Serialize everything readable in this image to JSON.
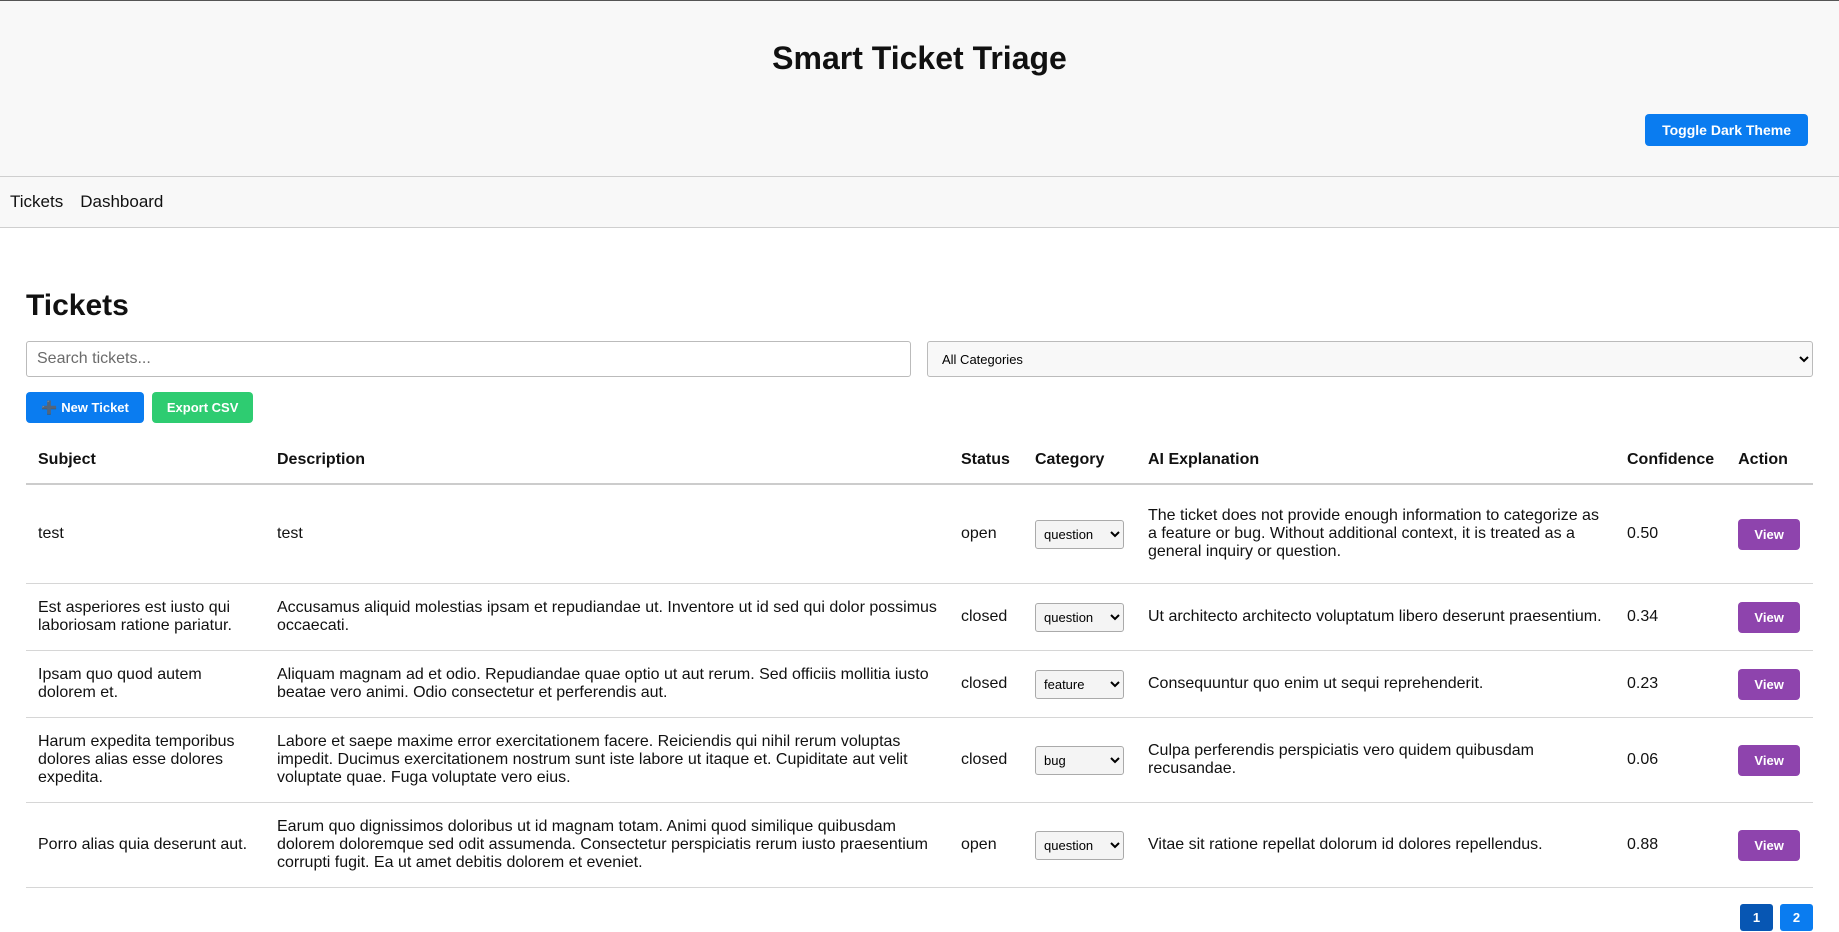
{
  "header": {
    "title": "Smart Ticket Triage",
    "theme_button": "Toggle Dark Theme"
  },
  "nav": {
    "items": [
      "Tickets",
      "Dashboard"
    ]
  },
  "page": {
    "title": "Tickets"
  },
  "filters": {
    "search_placeholder": "Search tickets...",
    "category_selected": "All Categories"
  },
  "actions": {
    "new_ticket": "New Ticket",
    "new_ticket_icon": "plus-icon",
    "export_csv": "Export CSV"
  },
  "colors": {
    "primary": "#0a7cf0",
    "success": "#2ecc71",
    "view": "#8e44ad",
    "active_page": "#0756b3"
  },
  "table": {
    "headers": [
      "Subject",
      "Description",
      "Status",
      "Category",
      "AI Explanation",
      "Confidence",
      "Action"
    ],
    "rows": [
      {
        "subject": "test",
        "description": "test",
        "status": "open",
        "category": "question",
        "ai_explanation": "The ticket does not provide enough information to categorize as a feature or bug. Without additional context, it is treated as a general inquiry or question.",
        "confidence": "0.50",
        "action": "View"
      },
      {
        "subject": "Est asperiores est iusto qui laboriosam ratione pariatur.",
        "description": "Accusamus aliquid molestias ipsam et repudiandae ut. Inventore ut id sed qui dolor possimus occaecati.",
        "status": "closed",
        "category": "question",
        "ai_explanation": "Ut architecto architecto voluptatum libero deserunt praesentium.",
        "confidence": "0.34",
        "action": "View"
      },
      {
        "subject": "Ipsam quo quod autem dolorem et.",
        "description": "Aliquam magnam ad et odio. Repudiandae quae optio ut aut rerum. Sed officiis mollitia iusto beatae vero animi. Odio consectetur et perferendis aut.",
        "status": "closed",
        "category": "feature",
        "ai_explanation": "Consequuntur quo enim ut sequi reprehenderit.",
        "confidence": "0.23",
        "action": "View"
      },
      {
        "subject": "Harum expedita temporibus dolores alias esse dolores expedita.",
        "description": "Labore et saepe maxime error exercitationem facere. Reiciendis qui nihil rerum voluptas impedit. Ducimus exercitationem nostrum sunt iste labore ut itaque et. Cupiditate aut velit voluptate quae. Fuga voluptate vero eius.",
        "status": "closed",
        "category": "bug",
        "ai_explanation": "Culpa perferendis perspiciatis vero quidem quibusdam recusandae.",
        "confidence": "0.06",
        "action": "View"
      },
      {
        "subject": "Porro alias quia deserunt aut.",
        "description": "Earum quo dignissimos doloribus ut id magnam totam. Animi quod similique quibusdam dolorem doloremque sed odit assumenda. Consectetur perspiciatis rerum iusto praesentium corrupti fugit. Ea ut amet debitis dolorem et eveniet.",
        "status": "open",
        "category": "question",
        "ai_explanation": "Vitae sit ratione repellat dolorum id dolores repellendus.",
        "confidence": "0.88",
        "action": "View"
      }
    ]
  },
  "pagination": {
    "pages": [
      "1",
      "2"
    ],
    "current": "1"
  }
}
